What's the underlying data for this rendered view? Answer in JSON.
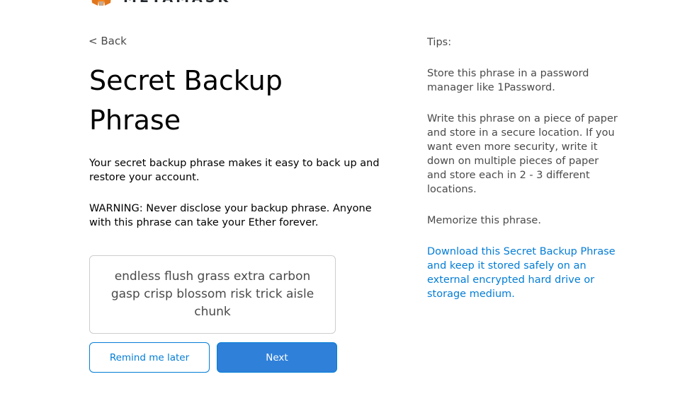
{
  "header": {
    "logo_text": "METAMASK"
  },
  "nav": {
    "back_label": "< Back"
  },
  "main": {
    "title": "Secret Backup Phrase",
    "description": "Your secret backup phrase makes it easy to back up and restore your account.",
    "warning": "WARNING: Never disclose your backup phrase. Anyone with this phrase can take your Ether forever.",
    "secret_phrase": "endless flush grass extra carbon gasp crisp blossom risk trick aisle chunk"
  },
  "actions": {
    "remind_later_label": "Remind me later",
    "next_label": "Next"
  },
  "tips": {
    "heading": "Tips:",
    "items": [
      "Store this phrase in a password manager like 1Password.",
      "Write this phrase on a piece of paper and store in a secure location. If you want even more security, write it down on multiple pieces of paper and store each in 2 - 3 different locations.",
      "Memorize this phrase."
    ],
    "download_link": "Download this Secret Backup Phrase and keep it stored safely on an external encrypted hard drive or storage medium."
  },
  "colors": {
    "primary": "#2f80d9",
    "link": "#037dd6",
    "fox_orange": "#f6851b"
  }
}
